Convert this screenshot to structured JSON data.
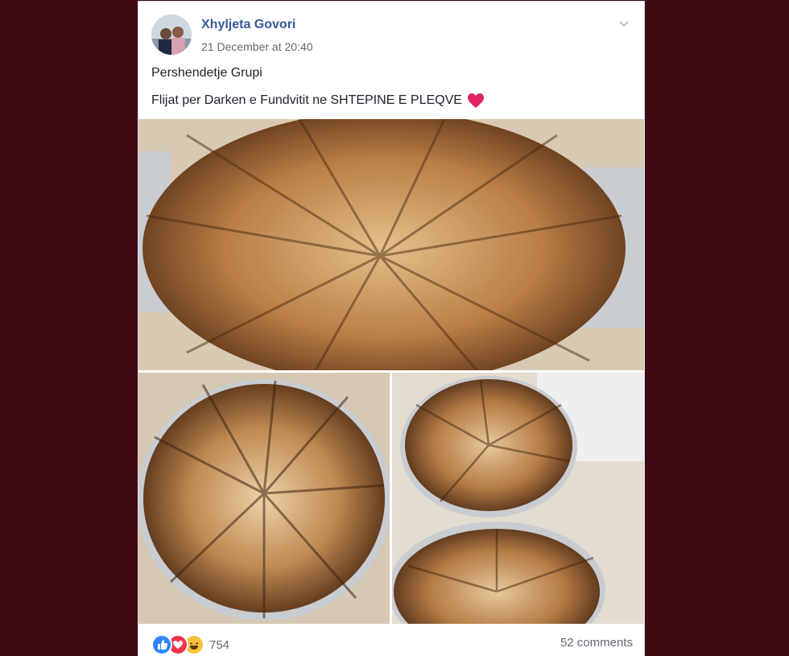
{
  "post": {
    "author": "Xhyljeta Govori",
    "timestamp": "21 December at 20:40",
    "line1": "Pershendetje Grupi",
    "line2": "Flijat per Darken e Fundvitit ne SHTEPINE E PLEQVE",
    "emoji": "heart-emoji"
  },
  "photos": [
    {
      "name": "flija-photo-1"
    },
    {
      "name": "flija-photo-2"
    },
    {
      "name": "flija-photo-3"
    }
  ],
  "footer": {
    "reaction_icons": [
      "like-icon",
      "love-icon",
      "haha-icon"
    ],
    "reaction_count": "754",
    "comments": "52 comments"
  },
  "colors": {
    "page_background": "#3d0a12",
    "author_link": "#365899",
    "meta_text": "#616770"
  }
}
